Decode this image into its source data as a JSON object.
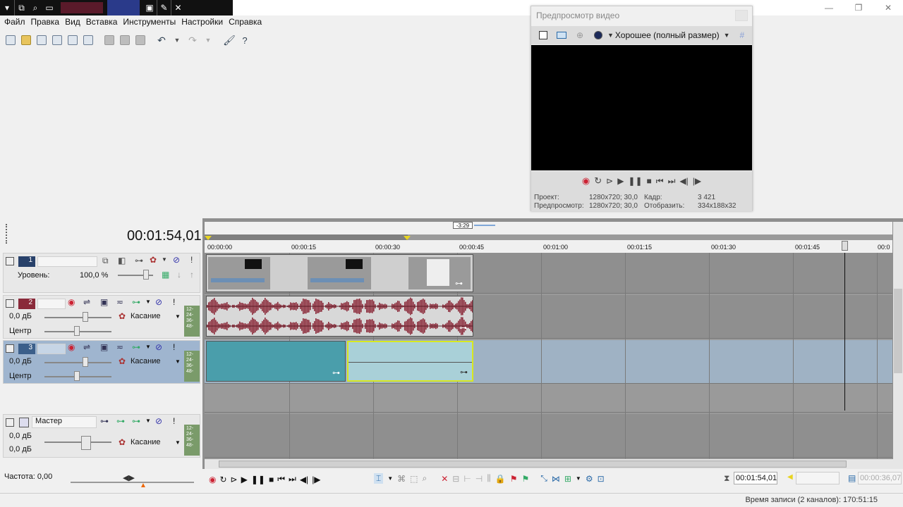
{
  "menu": [
    "Файл",
    "Правка",
    "Вид",
    "Вставка",
    "Инструменты",
    "Настройки",
    "Справка"
  ],
  "preview": {
    "title": "Предпросмотр видео",
    "quality": "Хорошее (полный размер)",
    "project_label": "Проект:",
    "project_value": "1280x720; 30,0",
    "preview_label": "Предпросмотр:",
    "preview_value": "1280x720; 30,0",
    "frame_label": "Кадр:",
    "frame_value": "3 421",
    "display_label": "Отобразить:",
    "display_value": "334x188x32"
  },
  "timeline": {
    "current_time": "00:01:54,01",
    "loop_marker": "-3:29",
    "ruler_ticks": [
      "00:00:00",
      "00:00:15",
      "00:00:30",
      "00:00:45",
      "00:01:00",
      "00:01:15",
      "00:01:30",
      "00:01:45",
      "00:0"
    ]
  },
  "tracks": [
    {
      "number": "1",
      "type": "video",
      "level_label": "Уровень:",
      "level_value": "100,0 %"
    },
    {
      "number": "2",
      "type": "audio",
      "volume": "0,0 дБ",
      "pan": "Центр",
      "mode": "Касание"
    },
    {
      "number": "3",
      "type": "audio",
      "volume": "0,0 дБ",
      "pan": "Центр",
      "mode": "Касание"
    }
  ],
  "master": {
    "label": "Мастер",
    "volume_l": "0,0 дБ",
    "volume_r": "0,0 дБ",
    "mode": "Касание"
  },
  "meter_labels": [
    "12-",
    "24-",
    "36-",
    "48-"
  ],
  "rate": {
    "label": "Частота: 0,00"
  },
  "transport_time": "00:01:54,01",
  "transport_time2": "00:00:36,07",
  "status": "Время записи (2 каналов): 170:51:15",
  "colors": {
    "audio_wave": "#8b2a3a",
    "teal_clip": "#4a9eab",
    "sel_clip": "#a9d0d8",
    "track_sel": "#9fb5cf"
  }
}
